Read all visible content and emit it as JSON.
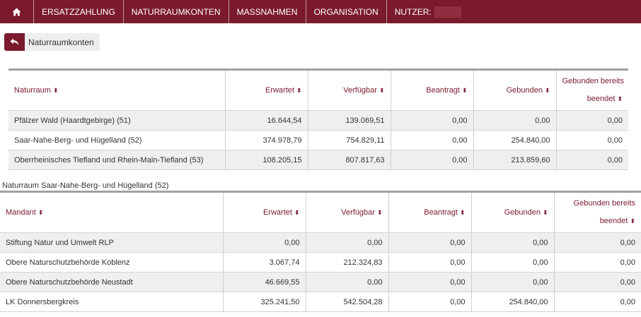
{
  "nav": {
    "home_icon": "home-icon",
    "items": [
      "ERSATZZAHLUNG",
      "NATURRAUMKONTEN",
      "MASSNAHMEN",
      "ORGANISATION"
    ],
    "user_label": "NUTZER:"
  },
  "back_button": {
    "label": "Naturraumkonten",
    "icon": "reply-arrow-icon"
  },
  "table1": {
    "headers": [
      "Naturraum",
      "Erwartet",
      "Verfügbar",
      "Beantragt",
      "Gebunden",
      "Gebunden bereits",
      "beendet"
    ],
    "rows": [
      [
        "Pfälzer Wald (Haardtgebirge) (51)",
        "16.644,54",
        "139.069,51",
        "0,00",
        "0,00",
        "0,00"
      ],
      [
        "Saar-Nahe-Berg- und Hügelland (52)",
        "374.978,79",
        "754.829,11",
        "0,00",
        "254.840,00",
        "0,00"
      ],
      [
        "Oberrheinisches Tiefland und Rhein-Main-Tiefland (53)",
        "108.205,15",
        "807.817,63",
        "0,00",
        "213.859,60",
        "0,00"
      ]
    ]
  },
  "section_caption": "Naturraum Saar-Nahe-Berg- und Hügelland (52)",
  "table2": {
    "headers": [
      "Mandant",
      "Erwartet",
      "Verfügbar",
      "Beantragt",
      "Gebunden",
      "Gebunden bereits",
      "beendet"
    ],
    "rows": [
      [
        "Stiftung Natur und Umwelt RLP",
        "0,00",
        "0,00",
        "0,00",
        "0,00",
        "0,00"
      ],
      [
        "Obere Naturschutzbehörde Koblenz",
        "3.067,74",
        "212.324,83",
        "0,00",
        "0,00",
        "0,00"
      ],
      [
        "Obere Naturschutzbehörde Neustadt",
        "46.669,55",
        "0,00",
        "0,00",
        "0,00",
        "0,00"
      ],
      [
        "LK Donnersbergkreis",
        "325.241,50",
        "542.504,28",
        "0,00",
        "254.840,00",
        "0,00"
      ]
    ]
  },
  "colors": {
    "brand": "#7a1a2c",
    "row_alt": "#efefef"
  }
}
